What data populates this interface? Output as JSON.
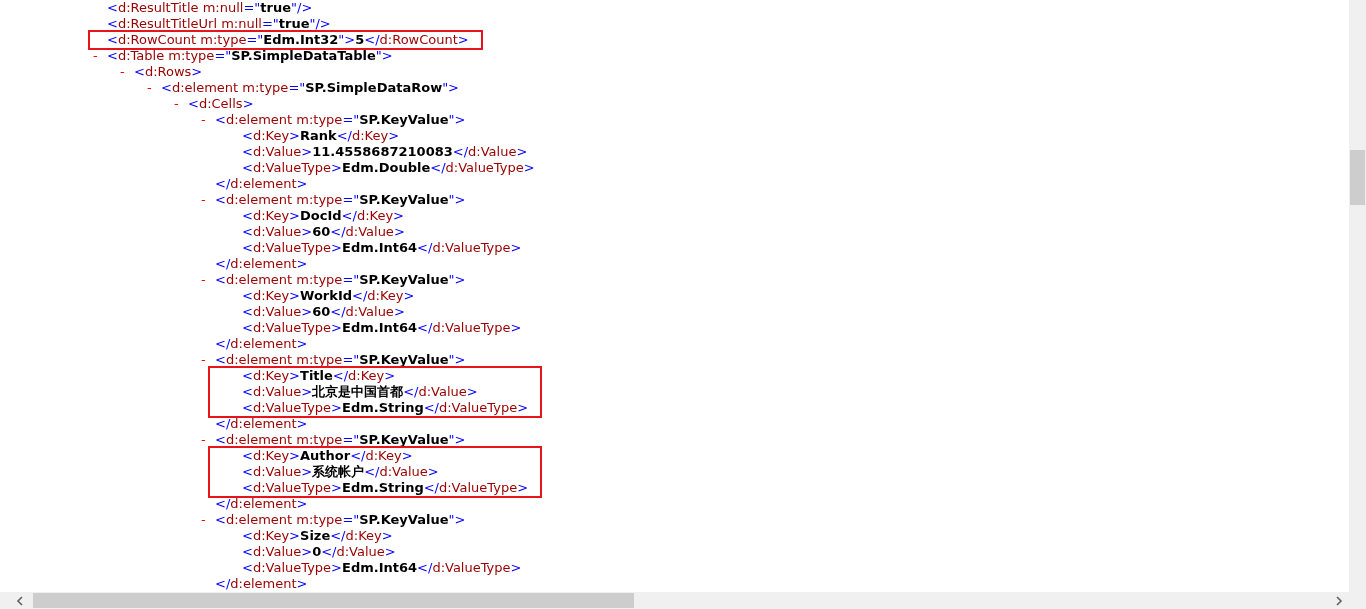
{
  "xml_tree": [
    {
      "highlighted": false,
      "open": [
        {
          "kind": "punct",
          "text": "<"
        },
        {
          "kind": "tag",
          "text": "d:ResultTitle m:null"
        },
        {
          "kind": "punct",
          "text": "=\""
        },
        {
          "kind": "value",
          "text": "true"
        },
        {
          "kind": "punct",
          "text": "\"/>"
        }
      ]
    },
    {
      "highlighted": false,
      "open": [
        {
          "kind": "punct",
          "text": "<"
        },
        {
          "kind": "tag",
          "text": "d:ResultTitleUrl m:null"
        },
        {
          "kind": "punct",
          "text": "=\""
        },
        {
          "kind": "value",
          "text": "true"
        },
        {
          "kind": "punct",
          "text": "\"/>"
        }
      ]
    },
    {
      "highlighted": true,
      "open": [
        {
          "kind": "punct",
          "text": "<"
        },
        {
          "kind": "tag",
          "text": "d:RowCount m:type"
        },
        {
          "kind": "punct",
          "text": "=\""
        },
        {
          "kind": "value",
          "text": "Edm.Int32"
        },
        {
          "kind": "punct",
          "text": "\">"
        },
        {
          "kind": "value",
          "text": "5"
        },
        {
          "kind": "punct",
          "text": "</"
        },
        {
          "kind": "tag",
          "text": "d:RowCount"
        },
        {
          "kind": "punct",
          "text": ">"
        }
      ]
    },
    {
      "highlighted": false,
      "toggle": "-",
      "expanded": true,
      "open": [
        {
          "kind": "punct",
          "text": "<"
        },
        {
          "kind": "tag",
          "text": "d:Table m:type"
        },
        {
          "kind": "punct",
          "text": "=\""
        },
        {
          "kind": "value",
          "text": "SP.SimpleDataTable"
        },
        {
          "kind": "punct",
          "text": "\">"
        }
      ],
      "children": [
        {
          "toggle": "-",
          "expanded": true,
          "open": [
            {
              "kind": "punct",
              "text": "<"
            },
            {
              "kind": "tag",
              "text": "d:Rows"
            },
            {
              "kind": "punct",
              "text": ">"
            }
          ],
          "children": [
            {
              "toggle": "-",
              "expanded": true,
              "open": [
                {
                  "kind": "punct",
                  "text": "<"
                },
                {
                  "kind": "tag",
                  "text": "d:element m:type"
                },
                {
                  "kind": "punct",
                  "text": "=\""
                },
                {
                  "kind": "value",
                  "text": "SP.SimpleDataRow"
                },
                {
                  "kind": "punct",
                  "text": "\">"
                }
              ],
              "children": [
                {
                  "toggle": "-",
                  "expanded": true,
                  "open": [
                    {
                      "kind": "punct",
                      "text": "<"
                    },
                    {
                      "kind": "tag",
                      "text": "d:Cells"
                    },
                    {
                      "kind": "punct",
                      "text": ">"
                    }
                  ],
                  "children": [
                    {
                      "highlighted": false,
                      "toggle": "-",
                      "expanded": true,
                      "open": [
                        {
                          "kind": "punct",
                          "text": "<"
                        },
                        {
                          "kind": "tag",
                          "text": "d:element m:type"
                        },
                        {
                          "kind": "punct",
                          "text": "=\""
                        },
                        {
                          "kind": "value",
                          "text": "SP.KeyValue"
                        },
                        {
                          "kind": "punct",
                          "text": "\">"
                        }
                      ],
                      "close": [
                        {
                          "kind": "punct",
                          "text": "</"
                        },
                        {
                          "kind": "tag",
                          "text": "d:element"
                        },
                        {
                          "kind": "punct",
                          "text": ">"
                        }
                      ],
                      "children": [
                        {
                          "open": [
                            {
                              "kind": "punct",
                              "text": "<"
                            },
                            {
                              "kind": "tag",
                              "text": "d:Key"
                            },
                            {
                              "kind": "punct",
                              "text": ">"
                            },
                            {
                              "kind": "value",
                              "text": "Rank"
                            },
                            {
                              "kind": "punct",
                              "text": "</"
                            },
                            {
                              "kind": "tag",
                              "text": "d:Key"
                            },
                            {
                              "kind": "punct",
                              "text": ">"
                            }
                          ]
                        },
                        {
                          "open": [
                            {
                              "kind": "punct",
                              "text": "<"
                            },
                            {
                              "kind": "tag",
                              "text": "d:Value"
                            },
                            {
                              "kind": "punct",
                              "text": ">"
                            },
                            {
                              "kind": "value",
                              "text": "11.4558687210083"
                            },
                            {
                              "kind": "punct",
                              "text": "</"
                            },
                            {
                              "kind": "tag",
                              "text": "d:Value"
                            },
                            {
                              "kind": "punct",
                              "text": ">"
                            }
                          ]
                        },
                        {
                          "open": [
                            {
                              "kind": "punct",
                              "text": "<"
                            },
                            {
                              "kind": "tag",
                              "text": "d:ValueType"
                            },
                            {
                              "kind": "punct",
                              "text": ">"
                            },
                            {
                              "kind": "value",
                              "text": "Edm.Double"
                            },
                            {
                              "kind": "punct",
                              "text": "</"
                            },
                            {
                              "kind": "tag",
                              "text": "d:ValueType"
                            },
                            {
                              "kind": "punct",
                              "text": ">"
                            }
                          ]
                        }
                      ]
                    },
                    {
                      "highlighted": false,
                      "toggle": "-",
                      "expanded": true,
                      "open": [
                        {
                          "kind": "punct",
                          "text": "<"
                        },
                        {
                          "kind": "tag",
                          "text": "d:element m:type"
                        },
                        {
                          "kind": "punct",
                          "text": "=\""
                        },
                        {
                          "kind": "value",
                          "text": "SP.KeyValue"
                        },
                        {
                          "kind": "punct",
                          "text": "\">"
                        }
                      ],
                      "close": [
                        {
                          "kind": "punct",
                          "text": "</"
                        },
                        {
                          "kind": "tag",
                          "text": "d:element"
                        },
                        {
                          "kind": "punct",
                          "text": ">"
                        }
                      ],
                      "children": [
                        {
                          "open": [
                            {
                              "kind": "punct",
                              "text": "<"
                            },
                            {
                              "kind": "tag",
                              "text": "d:Key"
                            },
                            {
                              "kind": "punct",
                              "text": ">"
                            },
                            {
                              "kind": "value",
                              "text": "DocId"
                            },
                            {
                              "kind": "punct",
                              "text": "</"
                            },
                            {
                              "kind": "tag",
                              "text": "d:Key"
                            },
                            {
                              "kind": "punct",
                              "text": ">"
                            }
                          ]
                        },
                        {
                          "open": [
                            {
                              "kind": "punct",
                              "text": "<"
                            },
                            {
                              "kind": "tag",
                              "text": "d:Value"
                            },
                            {
                              "kind": "punct",
                              "text": ">"
                            },
                            {
                              "kind": "value",
                              "text": "60"
                            },
                            {
                              "kind": "punct",
                              "text": "</"
                            },
                            {
                              "kind": "tag",
                              "text": "d:Value"
                            },
                            {
                              "kind": "punct",
                              "text": ">"
                            }
                          ]
                        },
                        {
                          "open": [
                            {
                              "kind": "punct",
                              "text": "<"
                            },
                            {
                              "kind": "tag",
                              "text": "d:ValueType"
                            },
                            {
                              "kind": "punct",
                              "text": ">"
                            },
                            {
                              "kind": "value",
                              "text": "Edm.Int64"
                            },
                            {
                              "kind": "punct",
                              "text": "</"
                            },
                            {
                              "kind": "tag",
                              "text": "d:ValueType"
                            },
                            {
                              "kind": "punct",
                              "text": ">"
                            }
                          ]
                        }
                      ]
                    },
                    {
                      "highlighted": false,
                      "toggle": "-",
                      "expanded": true,
                      "open": [
                        {
                          "kind": "punct",
                          "text": "<"
                        },
                        {
                          "kind": "tag",
                          "text": "d:element m:type"
                        },
                        {
                          "kind": "punct",
                          "text": "=\""
                        },
                        {
                          "kind": "value",
                          "text": "SP.KeyValue"
                        },
                        {
                          "kind": "punct",
                          "text": "\">"
                        }
                      ],
                      "close": [
                        {
                          "kind": "punct",
                          "text": "</"
                        },
                        {
                          "kind": "tag",
                          "text": "d:element"
                        },
                        {
                          "kind": "punct",
                          "text": ">"
                        }
                      ],
                      "children": [
                        {
                          "open": [
                            {
                              "kind": "punct",
                              "text": "<"
                            },
                            {
                              "kind": "tag",
                              "text": "d:Key"
                            },
                            {
                              "kind": "punct",
                              "text": ">"
                            },
                            {
                              "kind": "value",
                              "text": "WorkId"
                            },
                            {
                              "kind": "punct",
                              "text": "</"
                            },
                            {
                              "kind": "tag",
                              "text": "d:Key"
                            },
                            {
                              "kind": "punct",
                              "text": ">"
                            }
                          ]
                        },
                        {
                          "open": [
                            {
                              "kind": "punct",
                              "text": "<"
                            },
                            {
                              "kind": "tag",
                              "text": "d:Value"
                            },
                            {
                              "kind": "punct",
                              "text": ">"
                            },
                            {
                              "kind": "value",
                              "text": "60"
                            },
                            {
                              "kind": "punct",
                              "text": "</"
                            },
                            {
                              "kind": "tag",
                              "text": "d:Value"
                            },
                            {
                              "kind": "punct",
                              "text": ">"
                            }
                          ]
                        },
                        {
                          "open": [
                            {
                              "kind": "punct",
                              "text": "<"
                            },
                            {
                              "kind": "tag",
                              "text": "d:ValueType"
                            },
                            {
                              "kind": "punct",
                              "text": ">"
                            },
                            {
                              "kind": "value",
                              "text": "Edm.Int64"
                            },
                            {
                              "kind": "punct",
                              "text": "</"
                            },
                            {
                              "kind": "tag",
                              "text": "d:ValueType"
                            },
                            {
                              "kind": "punct",
                              "text": ">"
                            }
                          ]
                        }
                      ]
                    },
                    {
                      "highlighted": true,
                      "toggle": "-",
                      "expanded": true,
                      "open": [
                        {
                          "kind": "punct",
                          "text": "<"
                        },
                        {
                          "kind": "tag",
                          "text": "d:element m:type"
                        },
                        {
                          "kind": "punct",
                          "text": "=\""
                        },
                        {
                          "kind": "value",
                          "text": "SP.KeyValue"
                        },
                        {
                          "kind": "punct",
                          "text": "\">"
                        }
                      ],
                      "close": [
                        {
                          "kind": "punct",
                          "text": "</"
                        },
                        {
                          "kind": "tag",
                          "text": "d:element"
                        },
                        {
                          "kind": "punct",
                          "text": ">"
                        }
                      ],
                      "children": [
                        {
                          "open": [
                            {
                              "kind": "punct",
                              "text": "<"
                            },
                            {
                              "kind": "tag",
                              "text": "d:Key"
                            },
                            {
                              "kind": "punct",
                              "text": ">"
                            },
                            {
                              "kind": "value",
                              "text": "Title"
                            },
                            {
                              "kind": "punct",
                              "text": "</"
                            },
                            {
                              "kind": "tag",
                              "text": "d:Key"
                            },
                            {
                              "kind": "punct",
                              "text": ">"
                            }
                          ]
                        },
                        {
                          "open": [
                            {
                              "kind": "punct",
                              "text": "<"
                            },
                            {
                              "kind": "tag",
                              "text": "d:Value"
                            },
                            {
                              "kind": "punct",
                              "text": ">"
                            },
                            {
                              "kind": "value",
                              "text": "北京是中国首都"
                            },
                            {
                              "kind": "punct",
                              "text": "</"
                            },
                            {
                              "kind": "tag",
                              "text": "d:Value"
                            },
                            {
                              "kind": "punct",
                              "text": ">"
                            }
                          ]
                        },
                        {
                          "open": [
                            {
                              "kind": "punct",
                              "text": "<"
                            },
                            {
                              "kind": "tag",
                              "text": "d:ValueType"
                            },
                            {
                              "kind": "punct",
                              "text": ">"
                            },
                            {
                              "kind": "value",
                              "text": "Edm.String"
                            },
                            {
                              "kind": "punct",
                              "text": "</"
                            },
                            {
                              "kind": "tag",
                              "text": "d:ValueType"
                            },
                            {
                              "kind": "punct",
                              "text": ">"
                            }
                          ]
                        }
                      ]
                    },
                    {
                      "highlighted": true,
                      "toggle": "-",
                      "expanded": true,
                      "open": [
                        {
                          "kind": "punct",
                          "text": "<"
                        },
                        {
                          "kind": "tag",
                          "text": "d:element m:type"
                        },
                        {
                          "kind": "punct",
                          "text": "=\""
                        },
                        {
                          "kind": "value",
                          "text": "SP.KeyValue"
                        },
                        {
                          "kind": "punct",
                          "text": "\">"
                        }
                      ],
                      "close": [
                        {
                          "kind": "punct",
                          "text": "</"
                        },
                        {
                          "kind": "tag",
                          "text": "d:element"
                        },
                        {
                          "kind": "punct",
                          "text": ">"
                        }
                      ],
                      "children": [
                        {
                          "open": [
                            {
                              "kind": "punct",
                              "text": "<"
                            },
                            {
                              "kind": "tag",
                              "text": "d:Key"
                            },
                            {
                              "kind": "punct",
                              "text": ">"
                            },
                            {
                              "kind": "value",
                              "text": "Author"
                            },
                            {
                              "kind": "punct",
                              "text": "</"
                            },
                            {
                              "kind": "tag",
                              "text": "d:Key"
                            },
                            {
                              "kind": "punct",
                              "text": ">"
                            }
                          ]
                        },
                        {
                          "open": [
                            {
                              "kind": "punct",
                              "text": "<"
                            },
                            {
                              "kind": "tag",
                              "text": "d:Value"
                            },
                            {
                              "kind": "punct",
                              "text": ">"
                            },
                            {
                              "kind": "value",
                              "text": "系统帐户"
                            },
                            {
                              "kind": "punct",
                              "text": "</"
                            },
                            {
                              "kind": "tag",
                              "text": "d:Value"
                            },
                            {
                              "kind": "punct",
                              "text": ">"
                            }
                          ]
                        },
                        {
                          "open": [
                            {
                              "kind": "punct",
                              "text": "<"
                            },
                            {
                              "kind": "tag",
                              "text": "d:ValueType"
                            },
                            {
                              "kind": "punct",
                              "text": ">"
                            },
                            {
                              "kind": "value",
                              "text": "Edm.String"
                            },
                            {
                              "kind": "punct",
                              "text": "</"
                            },
                            {
                              "kind": "tag",
                              "text": "d:ValueType"
                            },
                            {
                              "kind": "punct",
                              "text": ">"
                            }
                          ]
                        }
                      ]
                    },
                    {
                      "highlighted": false,
                      "toggle": "-",
                      "expanded": true,
                      "open": [
                        {
                          "kind": "punct",
                          "text": "<"
                        },
                        {
                          "kind": "tag",
                          "text": "d:element m:type"
                        },
                        {
                          "kind": "punct",
                          "text": "=\""
                        },
                        {
                          "kind": "value",
                          "text": "SP.KeyValue"
                        },
                        {
                          "kind": "punct",
                          "text": "\">"
                        }
                      ],
                      "close": [
                        {
                          "kind": "punct",
                          "text": "</"
                        },
                        {
                          "kind": "tag",
                          "text": "d:element"
                        },
                        {
                          "kind": "punct",
                          "text": ">"
                        }
                      ],
                      "children": [
                        {
                          "open": [
                            {
                              "kind": "punct",
                              "text": "<"
                            },
                            {
                              "kind": "tag",
                              "text": "d:Key"
                            },
                            {
                              "kind": "punct",
                              "text": ">"
                            },
                            {
                              "kind": "value",
                              "text": "Size"
                            },
                            {
                              "kind": "punct",
                              "text": "</"
                            },
                            {
                              "kind": "tag",
                              "text": "d:Key"
                            },
                            {
                              "kind": "punct",
                              "text": ">"
                            }
                          ]
                        },
                        {
                          "open": [
                            {
                              "kind": "punct",
                              "text": "<"
                            },
                            {
                              "kind": "tag",
                              "text": "d:Value"
                            },
                            {
                              "kind": "punct",
                              "text": ">"
                            },
                            {
                              "kind": "value",
                              "text": "0"
                            },
                            {
                              "kind": "punct",
                              "text": "</"
                            },
                            {
                              "kind": "tag",
                              "text": "d:Value"
                            },
                            {
                              "kind": "punct",
                              "text": ">"
                            }
                          ]
                        },
                        {
                          "open": [
                            {
                              "kind": "punct",
                              "text": "<"
                            },
                            {
                              "kind": "tag",
                              "text": "d:ValueType"
                            },
                            {
                              "kind": "punct",
                              "text": ">"
                            },
                            {
                              "kind": "value",
                              "text": "Edm.Int64"
                            },
                            {
                              "kind": "punct",
                              "text": "</"
                            },
                            {
                              "kind": "tag",
                              "text": "d:ValueType"
                            },
                            {
                              "kind": "punct",
                              "text": ">"
                            }
                          ]
                        }
                      ]
                    }
                  ]
                }
              ]
            }
          ]
        }
      ]
    }
  ]
}
